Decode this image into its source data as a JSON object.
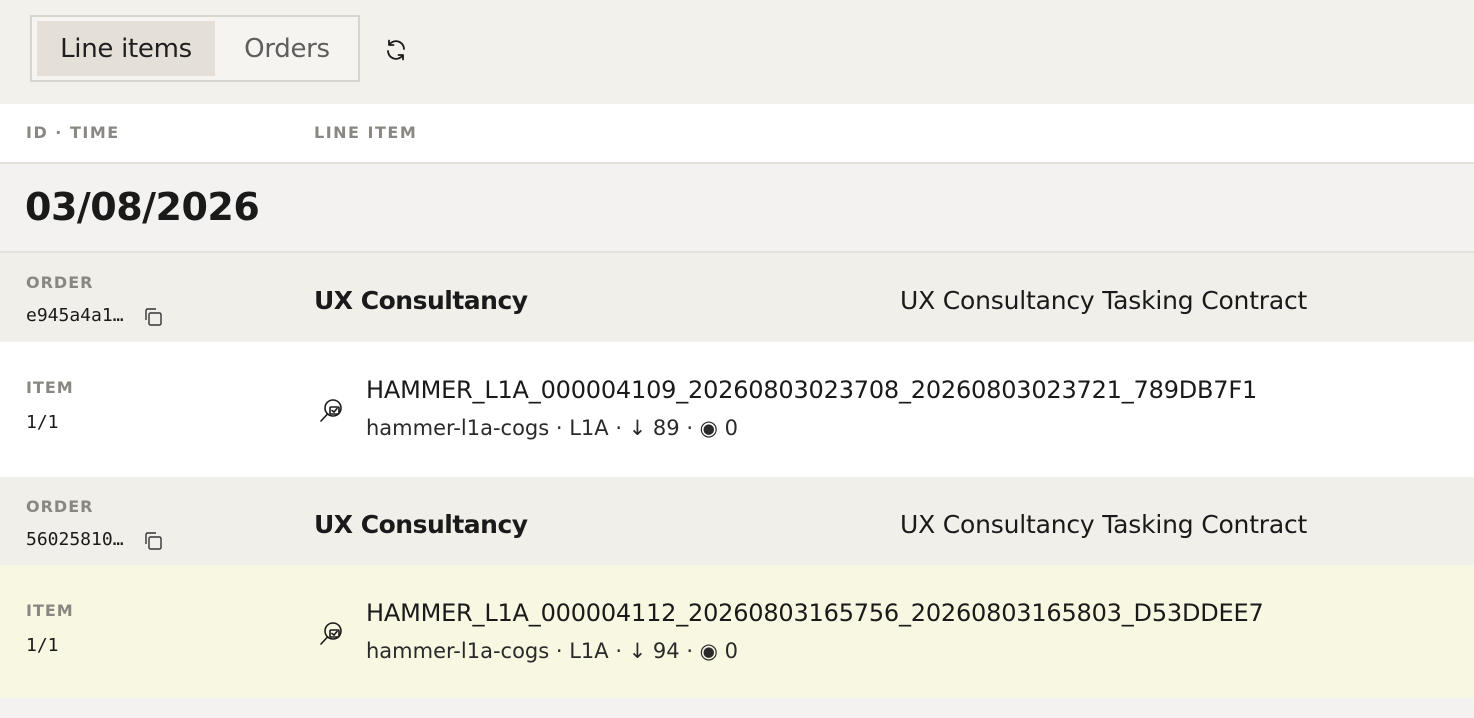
{
  "tabs": {
    "line_items": "Line items",
    "orders": "Orders"
  },
  "header": {
    "col_id_time": "ID · TIME",
    "col_line_item": "LINE ITEM"
  },
  "date_group": "03/08/2026",
  "rows": [
    {
      "order": {
        "label": "ORDER",
        "id": "e945a4a1…",
        "client": "UX Consultancy",
        "contract": "UX Consultancy Tasking Contract"
      },
      "item": {
        "label": "ITEM",
        "count": "1/1",
        "title": "HAMMER_L1A_000004109_20260803023708_20260803023721_789DB7F1",
        "meta": "hammer-l1a-cogs · L1A · ↓ 89 · ◉ 0"
      }
    },
    {
      "order": {
        "label": "ORDER",
        "id": "56025810…",
        "client": "UX Consultancy",
        "contract": "UX Consultancy Tasking Contract"
      },
      "item": {
        "label": "ITEM",
        "count": "1/1",
        "title": "HAMMER_L1A_000004112_20260803165756_20260803165803_D53DDEE7",
        "meta": "hammer-l1a-cogs · L1A · ↓ 94 · ◉ 0"
      }
    }
  ],
  "colors": {
    "selected_row": "#f8f7e1",
    "order_row": "#f1efea",
    "active_tab": "#e4e0d8"
  }
}
